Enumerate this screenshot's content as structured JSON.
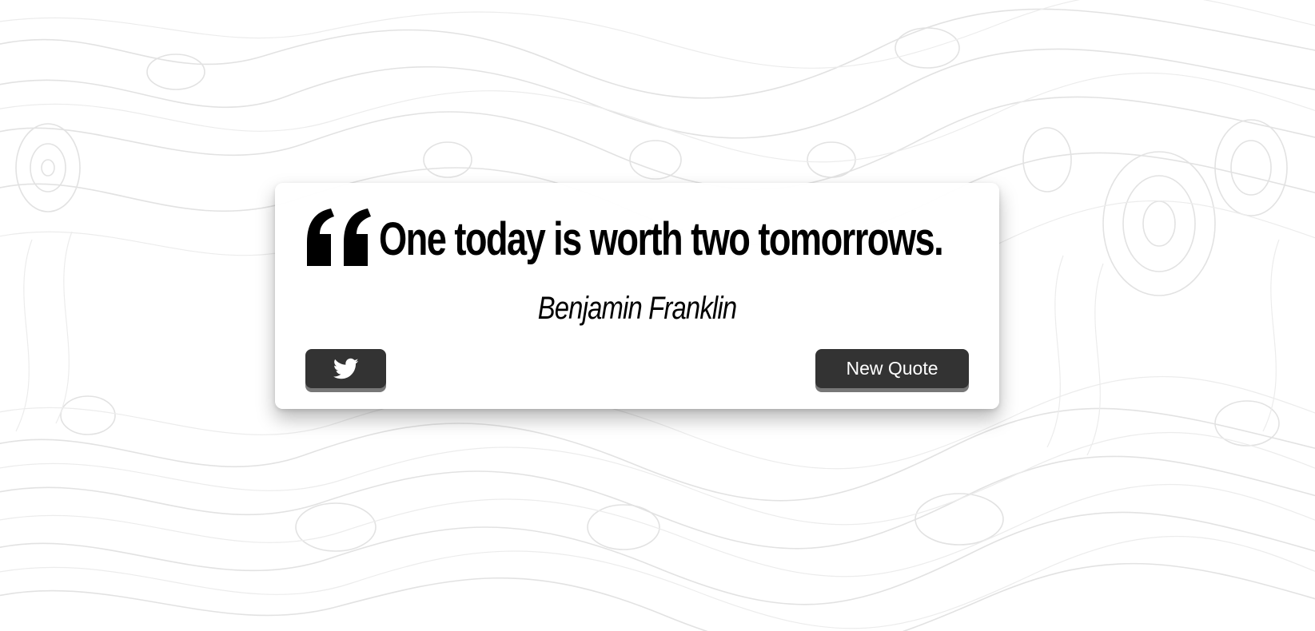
{
  "quote": {
    "text": "One today is worth two tomorrows.",
    "author": "Benjamin Franklin"
  },
  "buttons": {
    "tweet_icon": "twitter-icon",
    "new_quote_label": "New Quote"
  },
  "icons": {
    "quote_mark": "quote-left-icon"
  },
  "colors": {
    "button_bg": "#333333",
    "button_shadow": "#777777",
    "text": "#000000",
    "background": "#ffffff",
    "topo_lines": "#dddddd"
  }
}
